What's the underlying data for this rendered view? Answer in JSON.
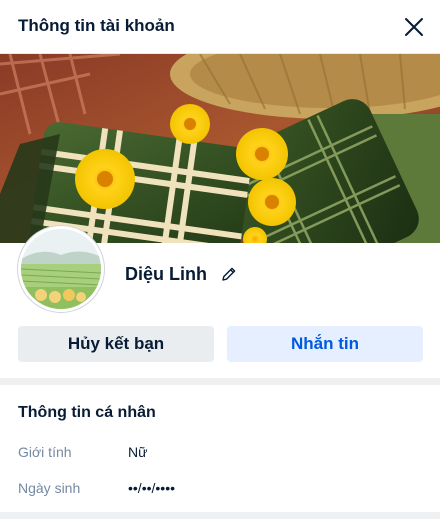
{
  "header": {
    "title": "Thông tin tài khoản",
    "close_icon": "close-icon"
  },
  "cover": {
    "image": "banh-chung-with-yellow-apricot-blossoms"
  },
  "profile": {
    "name": "Diệu Linh",
    "edit_icon": "pencil-icon"
  },
  "actions": {
    "unfriend_label": "Hủy kết bạn",
    "message_label": "Nhắn tin"
  },
  "personal_info": {
    "title": "Thông tin cá nhân",
    "rows": [
      {
        "label": "Giới tính",
        "value": "Nữ"
      },
      {
        "label": "Ngày sinh",
        "value": "••/••/••••"
      }
    ]
  },
  "colors": {
    "primary": "#005ae0",
    "primary_bg": "#e5efff",
    "secondary_bg": "#eaedf0",
    "text": "#081c36",
    "muted": "#7589a3"
  }
}
